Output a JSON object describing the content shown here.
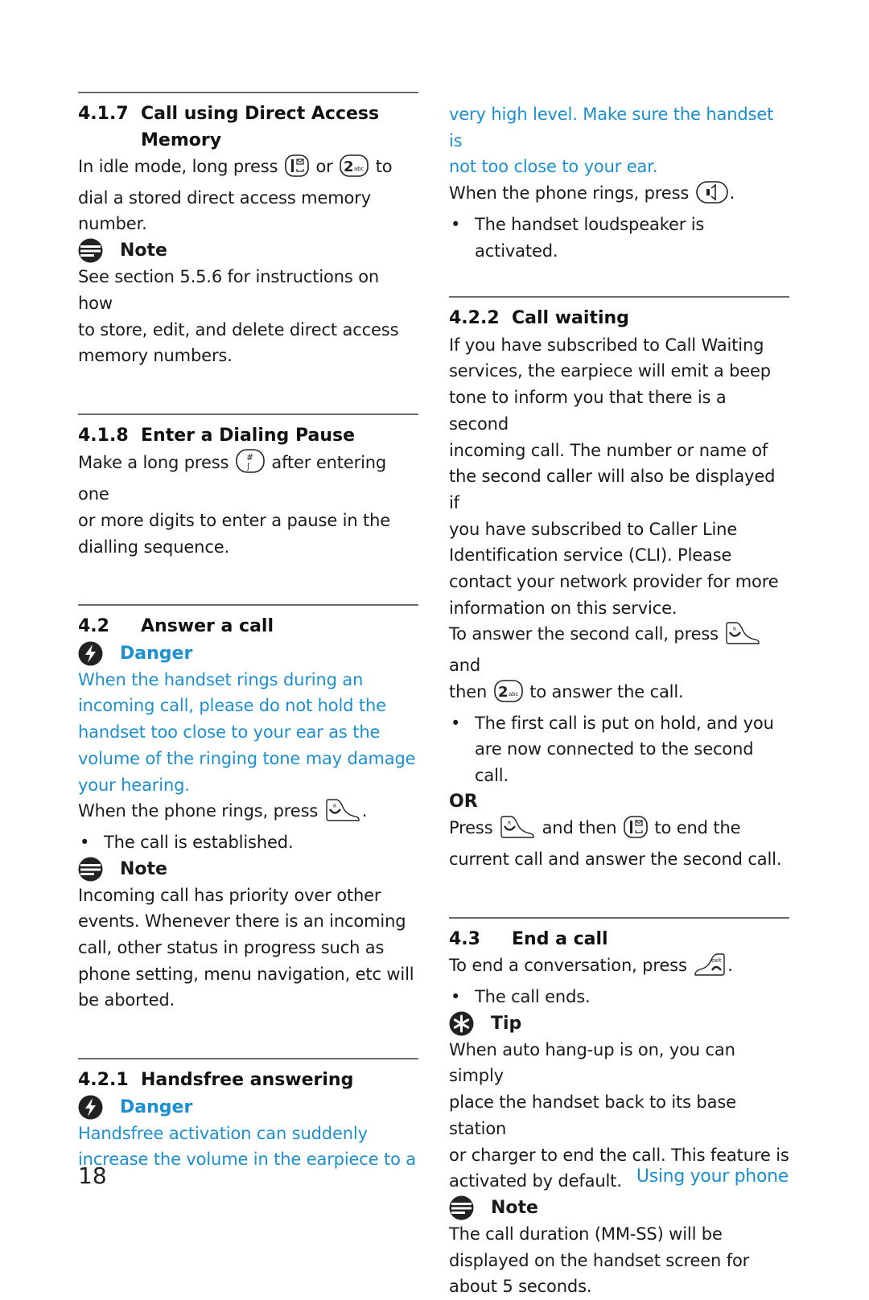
{
  "page": {
    "number": "18",
    "chapter": "Using your phone",
    "colors": {
      "accent": "#1b8fcf",
      "text": "#1a1a1a",
      "rule": "#6b6b6b"
    }
  },
  "left": {
    "s417": {
      "num": "4.1.7",
      "title": "Call using Direct Access Memory",
      "body_pre": "In idle mode, long press",
      "body_mid": "or",
      "body_post": "to",
      "body_lines": [
        "dial a stored direct access memory",
        "number."
      ],
      "note_label": "Note",
      "note_lines": [
        "See section 5.5.6 for instructions on how",
        "to store, edit, and delete direct access",
        "memory numbers."
      ]
    },
    "s418": {
      "num": "4.1.8",
      "title": "Enter a Dialing Pause",
      "body_pre": "Make a long press",
      "body_post": "after entering one",
      "body_lines": [
        "or more digits to enter a pause in the",
        "dialling sequence."
      ]
    },
    "s42": {
      "num": "4.2",
      "title": "Answer a call",
      "danger_label": "Danger",
      "danger_lines": [
        "When the handset rings during an",
        "incoming call, please do not hold the",
        "handset too close to your ear as the",
        "volume of the ringing tone may damage",
        "your hearing."
      ],
      "body_pre": "When the phone rings, press",
      "body_post": ".",
      "bullet": "The call is established.",
      "note_label": "Note",
      "note_lines": [
        "Incoming call has priority over other",
        "events. Whenever there is an incoming",
        "call, other status in progress such as",
        "phone setting, menu navigation, etc will",
        "be aborted."
      ]
    },
    "s421": {
      "num": "4.2.1",
      "title": "Handsfree answering",
      "danger_label": "Danger",
      "danger_lines": [
        "Handsfree activation can suddenly",
        "increase the volume in the earpiece to a"
      ]
    }
  },
  "right": {
    "s421_cont": {
      "danger_lines": [
        "very high level. Make sure the handset is",
        "not too close to your ear."
      ],
      "body_pre": "When the phone rings, press",
      "body_post": ".",
      "bullet": "The handset loudspeaker is activated."
    },
    "s422": {
      "num": "4.2.2",
      "title": "Call waiting",
      "body_lines": [
        "If you have subscribed to Call Waiting",
        "services, the earpiece will emit a beep",
        "tone to inform you that there is a second",
        "incoming call. The number or name of",
        "the second caller will also be displayed if",
        "you have subscribed to Caller Line",
        "Identification service (CLI). Please",
        "contact your network provider for more",
        "information on this service."
      ],
      "answer_pre": "To answer the second call, press",
      "answer_post": "and",
      "answer2_pre": "then",
      "answer2_post": "to answer the call.",
      "bullet_lines": [
        "The first call is put on hold, and you",
        "are now connected to the second call."
      ],
      "or_label": "OR",
      "press_pre": "Press",
      "press_mid": "and then",
      "press_post": "to end the",
      "press_line2": "current call and answer the second call."
    },
    "s43": {
      "num": "4.3",
      "title": "End a call",
      "body_pre": "To end a conversation, press",
      "body_post": ".",
      "bullet": "The call ends.",
      "tip_label": "Tip",
      "tip_lines": [
        "When auto hang-up is on, you can simply",
        "place the handset back to its base station",
        "or charger to end the call. This feature is",
        "activated by default."
      ],
      "note_label": "Note",
      "note_lines": [
        "The call duration (MM-SS) will be",
        "displayed on the handset screen for",
        "about 5 seconds."
      ]
    }
  },
  "icons": {
    "note": "note-icon",
    "danger": "danger-lightning-icon",
    "tip": "tip-asterisk-icon",
    "key1": "key-1-voicemail-icon",
    "key2": "key-2-abc-icon",
    "keyHash": "key-hash-pause-icon",
    "talk": "talk-r-key-icon",
    "speaker": "speaker-key-icon",
    "exit": "end-exit-key-icon"
  }
}
